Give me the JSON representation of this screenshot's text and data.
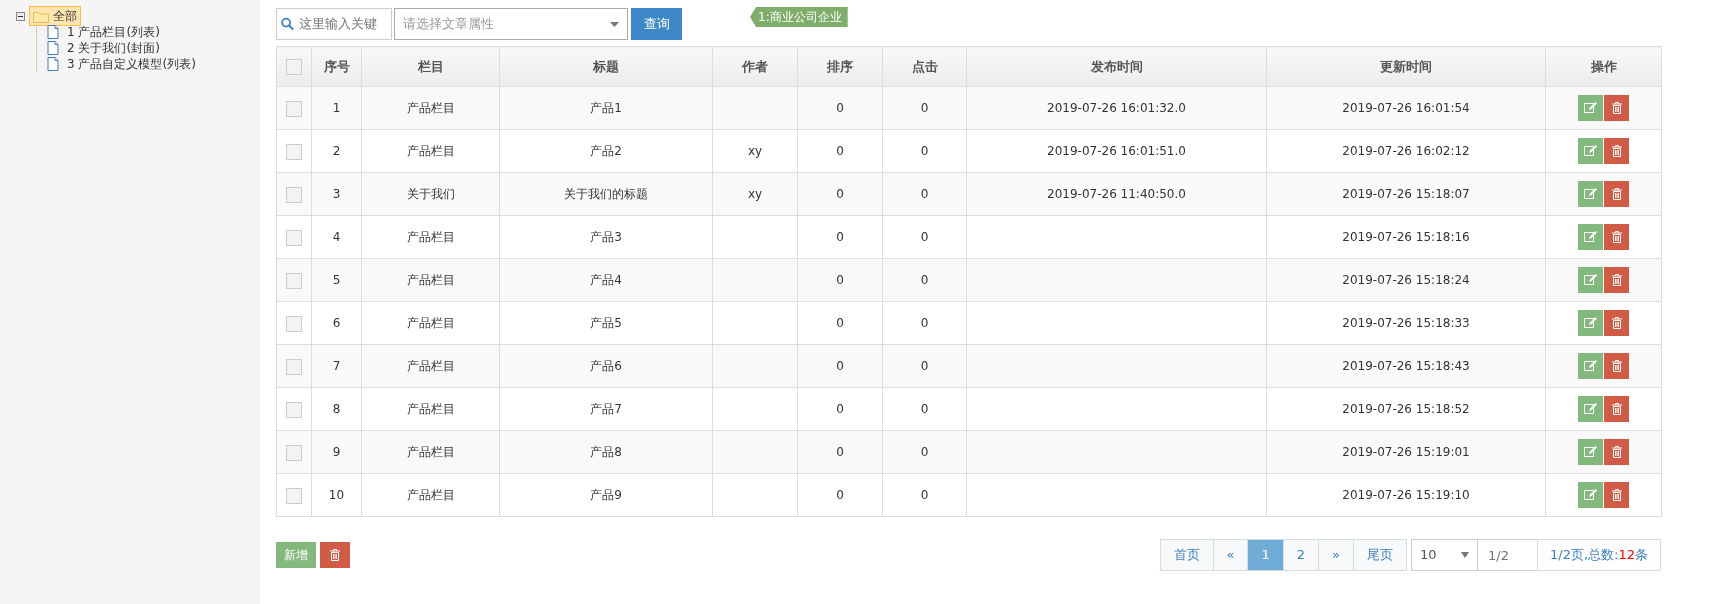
{
  "tree": {
    "label": "全部",
    "expanded": true,
    "selected": true,
    "children": [
      {
        "label": "1 产品栏目(列表)",
        "selected": false
      },
      {
        "label": "2 关于我们(封面)",
        "selected": false
      },
      {
        "label": "3 产品自定义模型(列表)",
        "selected": false
      }
    ]
  },
  "toolbar": {
    "keyword": {
      "placeholder": "这里输入关键"
    },
    "attribute": {
      "placeholder": "请选择文章属性"
    },
    "search_button": "查询",
    "tag": "1:商业公司企业"
  },
  "table": {
    "all_checked": false,
    "columns": [
      "序号",
      "栏目",
      "标题",
      "作者",
      "排序",
      "点击",
      "发布时间",
      "更新时间",
      "操作"
    ],
    "rows": [
      {
        "checked": false,
        "cells": [
          "1",
          "产品栏目",
          "产品1",
          "",
          "0",
          "0",
          "2019-07-26 16:01:32.0",
          "2019-07-26 16:01:54"
        ]
      },
      {
        "checked": false,
        "cells": [
          "2",
          "产品栏目",
          "产品2",
          "xy",
          "0",
          "0",
          "2019-07-26 16:01:51.0",
          "2019-07-26 16:02:12"
        ]
      },
      {
        "checked": false,
        "cells": [
          "3",
          "关于我们",
          "关于我们的标题",
          "xy",
          "0",
          "0",
          "2019-07-26 11:40:50.0",
          "2019-07-26 15:18:07"
        ]
      },
      {
        "checked": false,
        "cells": [
          "4",
          "产品栏目",
          "产品3",
          "",
          "0",
          "0",
          "",
          "2019-07-26 15:18:16"
        ]
      },
      {
        "checked": false,
        "cells": [
          "5",
          "产品栏目",
          "产品4",
          "",
          "0",
          "0",
          "",
          "2019-07-26 15:18:24"
        ]
      },
      {
        "checked": false,
        "cells": [
          "6",
          "产品栏目",
          "产品5",
          "",
          "0",
          "0",
          "",
          "2019-07-26 15:18:33"
        ]
      },
      {
        "checked": false,
        "cells": [
          "7",
          "产品栏目",
          "产品6",
          "",
          "0",
          "0",
          "",
          "2019-07-26 15:18:43"
        ]
      },
      {
        "checked": false,
        "cells": [
          "8",
          "产品栏目",
          "产品7",
          "",
          "0",
          "0",
          "",
          "2019-07-26 15:18:52"
        ]
      },
      {
        "checked": false,
        "cells": [
          "9",
          "产品栏目",
          "产品8",
          "",
          "0",
          "0",
          "",
          "2019-07-26 15:19:01"
        ]
      },
      {
        "checked": false,
        "cells": [
          "10",
          "产品栏目",
          "产品9",
          "",
          "0",
          "0",
          "",
          "2019-07-26 15:19:10"
        ]
      }
    ]
  },
  "footer": {
    "add_button": "新增"
  },
  "pagination": {
    "pages": [
      {
        "label": "首页",
        "selected": false
      },
      {
        "label": "«",
        "selected": false
      },
      {
        "label": "1",
        "selected": true
      },
      {
        "label": "2",
        "selected": false
      },
      {
        "label": "»",
        "selected": false
      },
      {
        "label": "尾页",
        "selected": false
      }
    ],
    "page_size": "10",
    "page_input": {
      "placeholder": "1/2"
    },
    "info_prefix": "1/2页,总数:",
    "total": "12",
    "info_suffix": "条"
  }
}
